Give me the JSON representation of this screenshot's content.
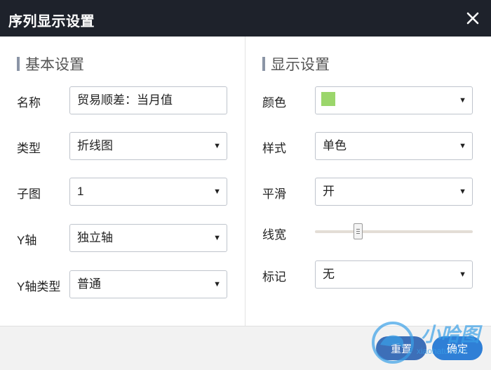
{
  "dialog": {
    "title": "序列显示设置"
  },
  "basic": {
    "heading": "基本设置",
    "name": {
      "label": "名称",
      "value": "贸易顺差：当月值"
    },
    "type": {
      "label": "类型",
      "value": "折线图"
    },
    "subplot": {
      "label": "子图",
      "value": "1"
    },
    "y_axis": {
      "label": "Y轴",
      "value": "独立轴"
    },
    "y_axis_type": {
      "label": "Y轴类型",
      "value": "普通"
    }
  },
  "display": {
    "heading": "显示设置",
    "color": {
      "label": "颜色",
      "value": "#9bd66b"
    },
    "style": {
      "label": "样式",
      "value": "单色"
    },
    "smooth": {
      "label": "平滑",
      "value": "开"
    },
    "line_width": {
      "label": "线宽",
      "level": 0.27
    },
    "marker": {
      "label": "标记",
      "value": "无"
    }
  },
  "footer": {
    "reset_label": "重置",
    "ok_label": "确定"
  },
  "watermark": {
    "text": "小哈图",
    "url": "xiaohatu.com"
  },
  "icons": {
    "close": "close-icon",
    "dropdown": "chevron-down-icon"
  }
}
